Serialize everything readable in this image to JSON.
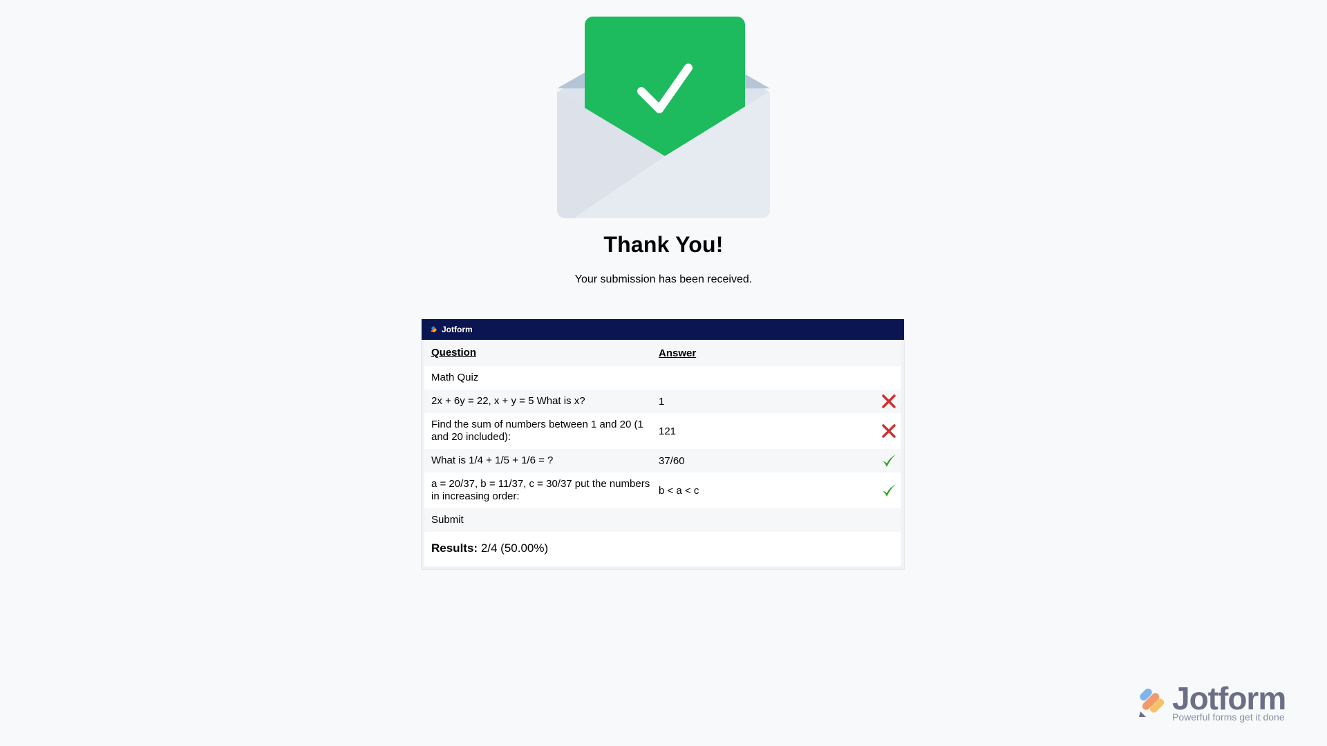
{
  "confirmation": {
    "title": "Thank You!",
    "subtitle": "Your submission has been received."
  },
  "report": {
    "brand": "Jotform",
    "headers": {
      "question": "Question",
      "answer": "Answer"
    },
    "section": "Math Quiz",
    "rows": [
      {
        "question": "2x + 6y = 22, x + y = 5 What is x?",
        "answer": "1",
        "correct": false
      },
      {
        "question": "Find the sum of numbers between 1 and 20 (1 and 20 included):",
        "answer": "121",
        "correct": false
      },
      {
        "question": "What is 1/4 + 1/5 + 1/6 = ?",
        "answer": "37/60",
        "correct": true
      },
      {
        "question": "a = 20/37, b = 11/37, c = 30/37 put the numbers in increasing order:",
        "answer": "b < a < c",
        "correct": true
      }
    ],
    "submit": "Submit",
    "results_label": "Results:",
    "results_value": "2/4 (50.00%)"
  },
  "footer": {
    "brand": "Jotform",
    "tagline": "Powerful forms get it done"
  },
  "colors": {
    "success_green": "#1dbb5e",
    "wrong_red": "#d0302c",
    "right_green": "#25a520",
    "header_navy": "#0a1551"
  },
  "icons": {
    "envelope": "envelope-check-icon",
    "wrong": "cross-icon",
    "right": "checkmark-icon"
  }
}
